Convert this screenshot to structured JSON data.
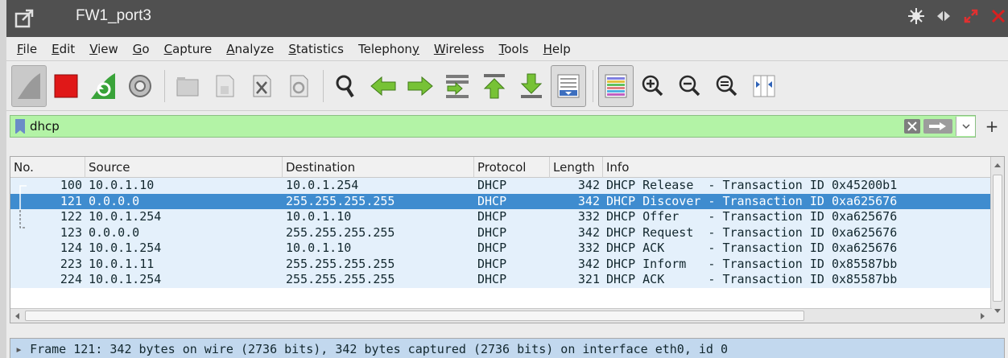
{
  "window": {
    "title": "FW1_port3"
  },
  "menu": [
    "File",
    "Edit",
    "View",
    "Go",
    "Capture",
    "Analyze",
    "Statistics",
    "Telephony",
    "Wireless",
    "Tools",
    "Help"
  ],
  "menu_mnemonic": [
    "F",
    "E",
    "V",
    "G",
    "C",
    "A",
    "S",
    "y",
    "W",
    "T",
    "H"
  ],
  "toolbar": {
    "icons": [
      "shark-fin-start-icon",
      "stop-capture-icon",
      "restart-capture-icon",
      "capture-options-icon",
      "open-file-icon",
      "save-file-icon",
      "close-file-icon",
      "reload-file-icon",
      "find-packet-icon",
      "go-back-icon",
      "go-forward-icon",
      "go-to-packet-icon",
      "first-packet-icon",
      "last-packet-icon",
      "autoscroll-icon",
      "colorize-icon",
      "zoom-in-icon",
      "zoom-out-icon",
      "normal-size-icon",
      "resize-columns-icon"
    ]
  },
  "filter": {
    "value": "dhcp"
  },
  "packet_list": {
    "columns": [
      "No.",
      "Source",
      "Destination",
      "Protocol",
      "Length",
      "Info"
    ],
    "rows": [
      {
        "no": "100",
        "src": "10.0.1.10",
        "dst": "10.0.1.254",
        "proto": "DHCP",
        "len": "342",
        "info": "DHCP Release  - Transaction ID 0x45200b1",
        "selected": false
      },
      {
        "no": "121",
        "src": "0.0.0.0",
        "dst": "255.255.255.255",
        "proto": "DHCP",
        "len": "342",
        "info": "DHCP Discover - Transaction ID 0xa625676",
        "selected": true
      },
      {
        "no": "122",
        "src": "10.0.1.254",
        "dst": "10.0.1.10",
        "proto": "DHCP",
        "len": "332",
        "info": "DHCP Offer    - Transaction ID 0xa625676",
        "selected": false
      },
      {
        "no": "123",
        "src": "0.0.0.0",
        "dst": "255.255.255.255",
        "proto": "DHCP",
        "len": "342",
        "info": "DHCP Request  - Transaction ID 0xa625676",
        "selected": false
      },
      {
        "no": "124",
        "src": "10.0.1.254",
        "dst": "10.0.1.10",
        "proto": "DHCP",
        "len": "332",
        "info": "DHCP ACK      - Transaction ID 0xa625676",
        "selected": false
      },
      {
        "no": "223",
        "src": "10.0.1.11",
        "dst": "255.255.255.255",
        "proto": "DHCP",
        "len": "342",
        "info": "DHCP Inform   - Transaction ID 0x85587bb",
        "selected": false
      },
      {
        "no": "224",
        "src": "10.0.1.254",
        "dst": "255.255.255.255",
        "proto": "DHCP",
        "len": "321",
        "info": "DHCP ACK      - Transaction ID 0x85587bb",
        "selected": false
      }
    ]
  },
  "details": {
    "line": "Frame 121: 342 bytes on wire (2736 bits), 342 bytes captured (2736 bits) on interface eth0, id 0"
  },
  "colors": {
    "titlebar": "#505050",
    "filter_ok": "#b3f3a6",
    "row_bg": "#e4f0fb",
    "row_selected": "#3f8ccf",
    "detail_bg": "#c2d8ee"
  }
}
